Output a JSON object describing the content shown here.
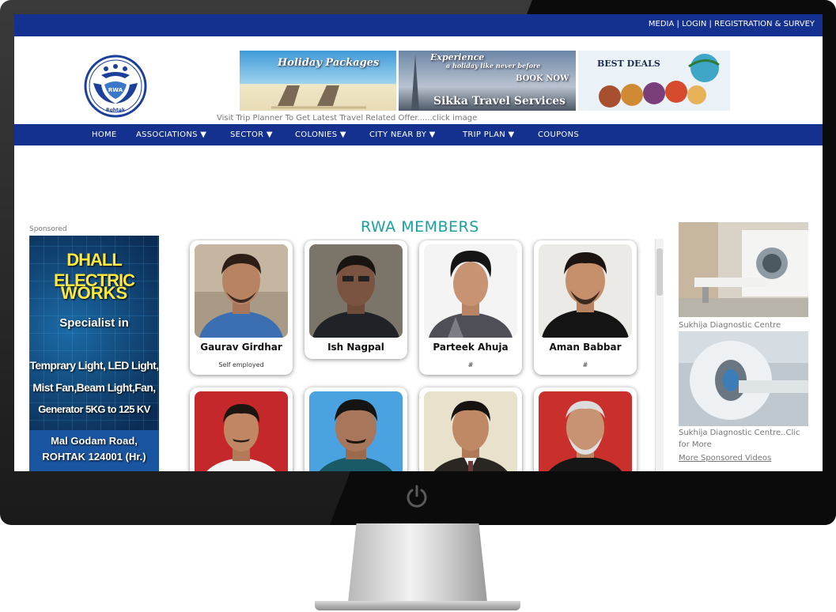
{
  "top_links": {
    "media": "MEDIA",
    "login": "LOGIN",
    "registration": "REGISTRATION & SURVEY",
    "separator": " | "
  },
  "logo": {
    "text": "RWA",
    "city": "Rohtak"
  },
  "banners": {
    "holiday": "Holiday Packages",
    "experience": "Experience",
    "experience_sub": "a holiday like never before",
    "book": "BOOK NOW",
    "sikka": "Sikka Travel Services",
    "deals": "BEST DEALS"
  },
  "visit_text": "Visit Trip Planner To Get Latest Travel Related Offer......click image",
  "nav": [
    {
      "label": "HOME"
    },
    {
      "label": "ASSOCIATIONS ▼"
    },
    {
      "label": "SECTOR ▼"
    },
    {
      "label": "COLONIES ▼"
    },
    {
      "label": "CITY NEAR BY ▼"
    },
    {
      "label": "TRIP PLAN ▼"
    },
    {
      "label": "COUPONS"
    }
  ],
  "sponsored_label": "Sponsored",
  "left_ad": {
    "l1": "DHALL ELECTRIC",
    "l2": "WORKS",
    "l3": "Specialist in",
    "l4": "Temprary Light, LED Light,",
    "l5": "Mist Fan,Beam Light,Fan,",
    "l6": "Generator 5KG to 125 KV",
    "l7": "Mal Godam Road,",
    "l8": "ROHTAK 124001 (Hr.)"
  },
  "section_title": "RWA MEMBERS",
  "members": [
    {
      "name": "Gaurav Girdhar",
      "sub": "Self employed"
    },
    {
      "name": "Ish Nagpal",
      "sub": ""
    },
    {
      "name": "Parteek Ahuja",
      "sub": "#"
    },
    {
      "name": "Aman Babbar",
      "sub": "#"
    },
    {
      "name": "",
      "sub": ""
    },
    {
      "name": "",
      "sub": ""
    },
    {
      "name": "",
      "sub": ""
    },
    {
      "name": "",
      "sub": ""
    }
  ],
  "right_ads": {
    "cap1": "Sukhija Diagnostic Centre",
    "cap2": "Sukhija Diagnostic Centre..Clic for More",
    "more": "More Sponsored Videos"
  },
  "colors": {
    "nav_blue": "#15318f",
    "title_teal": "#1aa0a0"
  }
}
